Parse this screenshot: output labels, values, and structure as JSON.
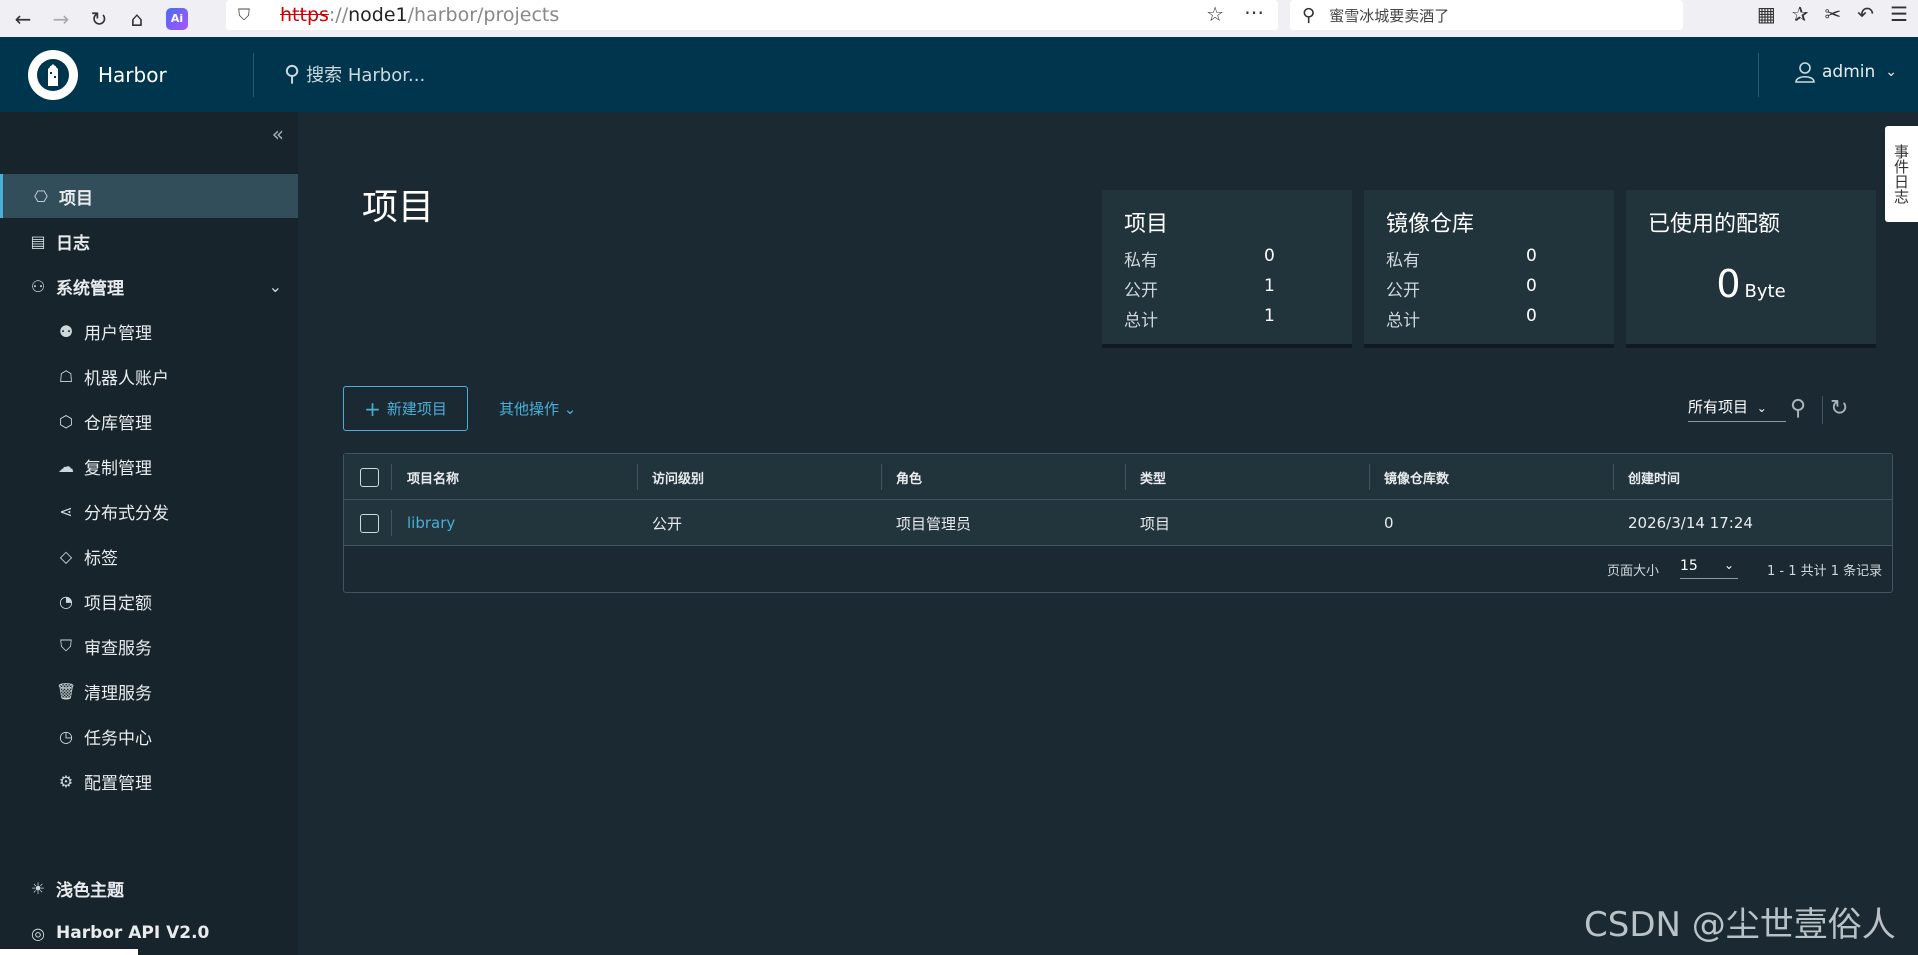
{
  "browser": {
    "ai_badge": "Ai",
    "url_protocol": "https",
    "url_sep": "://",
    "url_host": "node1",
    "url_path": "/harbor/projects",
    "search_text": "蜜雪冰城要卖酒了"
  },
  "header": {
    "brand": "Harbor",
    "search_placeholder": "搜索 Harbor...",
    "user": "admin"
  },
  "sidebar": {
    "items": [
      {
        "label": "项目",
        "icon": "projects-icon"
      },
      {
        "label": "日志",
        "icon": "logs-icon"
      },
      {
        "label": "系统管理",
        "icon": "admin-icon"
      },
      {
        "label": "用户管理",
        "icon": "users-icon"
      },
      {
        "label": "机器人账户",
        "icon": "robot-icon"
      },
      {
        "label": "仓库管理",
        "icon": "registry-icon"
      },
      {
        "label": "复制管理",
        "icon": "replication-icon"
      },
      {
        "label": "分布式分发",
        "icon": "distribution-icon"
      },
      {
        "label": "标签",
        "icon": "tag-icon"
      },
      {
        "label": "项目定额",
        "icon": "quota-icon"
      },
      {
        "label": "审查服务",
        "icon": "shield-icon"
      },
      {
        "label": "清理服务",
        "icon": "trash-icon"
      },
      {
        "label": "任务中心",
        "icon": "dashboard-icon"
      },
      {
        "label": "配置管理",
        "icon": "gear-icon"
      }
    ],
    "theme": "浅色主题",
    "api": "Harbor API V2.0"
  },
  "main": {
    "title": "项目",
    "cards": {
      "projects": {
        "title": "项目",
        "rows": [
          {
            "k": "私有",
            "v": "0"
          },
          {
            "k": "公开",
            "v": "1"
          },
          {
            "k": "总计",
            "v": "1"
          }
        ]
      },
      "repos": {
        "title": "镜像仓库",
        "rows": [
          {
            "k": "私有",
            "v": "0"
          },
          {
            "k": "公开",
            "v": "0"
          },
          {
            "k": "总计",
            "v": "0"
          }
        ]
      },
      "quota": {
        "title": "已使用的配额",
        "value": "0",
        "unit": "Byte"
      }
    },
    "new_project": "新建项目",
    "other_actions": "其他操作",
    "filter": "所有项目",
    "table": {
      "headers": [
        "项目名称",
        "访问级别",
        "角色",
        "类型",
        "镜像仓库数",
        "创建时间"
      ],
      "rows": [
        [
          "library",
          "公开",
          "项目管理员",
          "项目",
          "0",
          "2026/3/14 17:24"
        ]
      ],
      "page_size_label": "页面大小",
      "page_size": "15",
      "summary": "1 - 1 共计 1 条记录"
    }
  },
  "event_log": "事件日志",
  "watermark": "CSDN @尘世壹俗人",
  "colors": {
    "accent": "#49afd9",
    "header": "#00364d",
    "bg": "#1b2a32"
  }
}
